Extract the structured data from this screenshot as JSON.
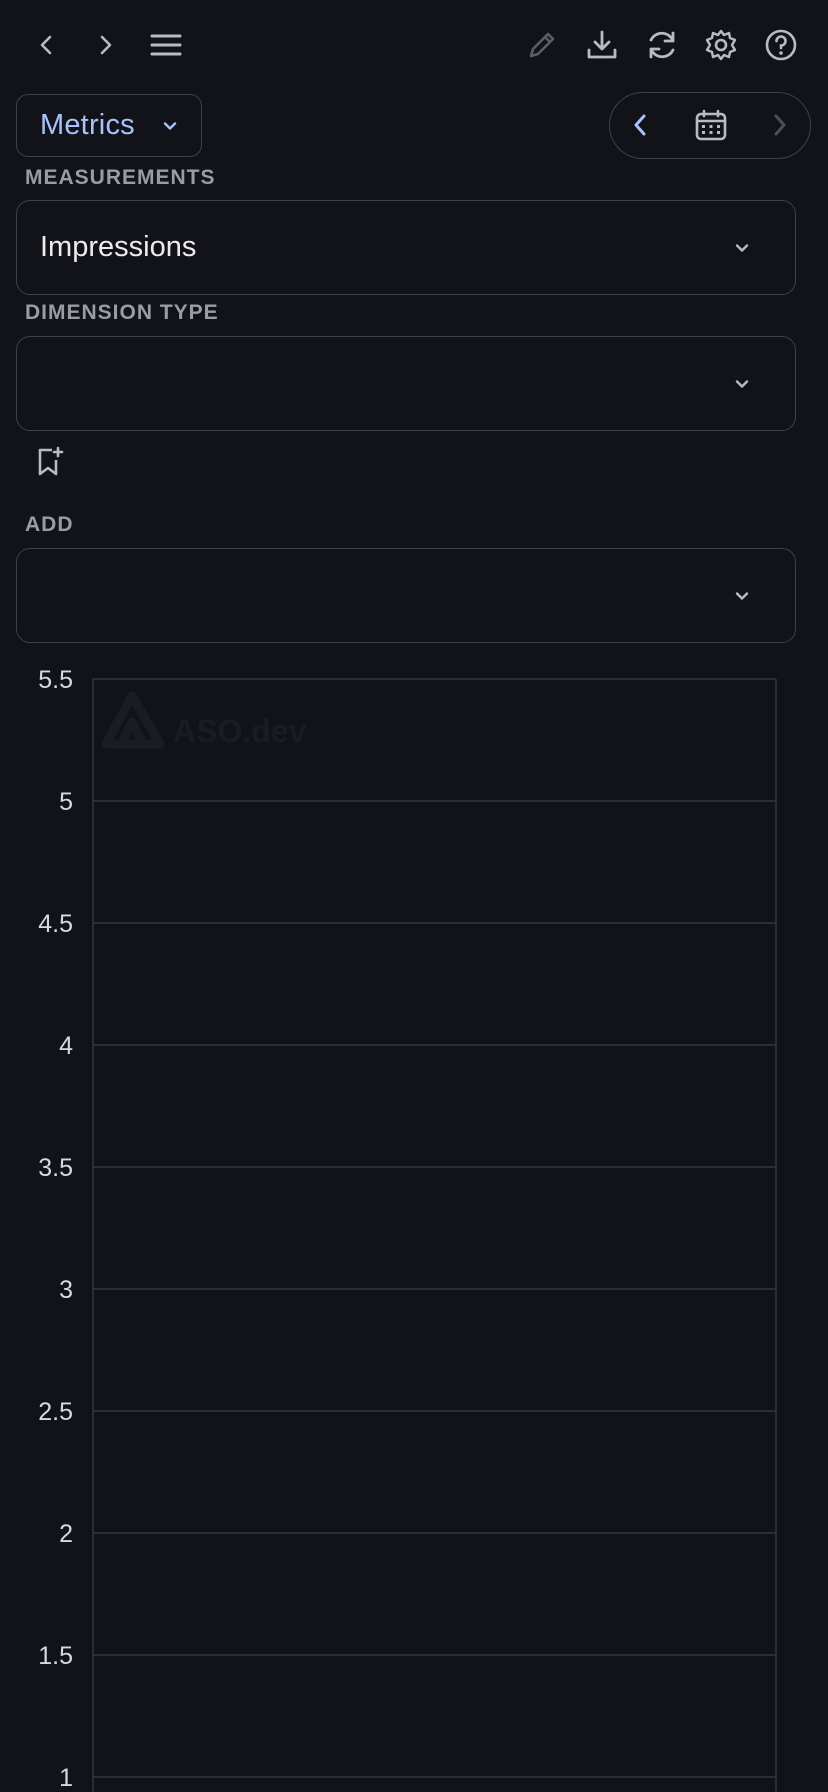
{
  "toolbar": {
    "icons": [
      "chevron-left-icon",
      "chevron-right-icon",
      "menu-icon",
      "pencil-icon",
      "download-icon",
      "refresh-icon",
      "gear-icon",
      "help-icon"
    ]
  },
  "metrics_menu": {
    "label": "Metrics"
  },
  "date_nav": {
    "icons": [
      "chevron-left-icon",
      "calendar-icon",
      "chevron-right-icon"
    ]
  },
  "measurements": {
    "label": "MEASUREMENTS",
    "value": "Impressions"
  },
  "dimension_type": {
    "label": "DIMENSION TYPE",
    "value": ""
  },
  "add": {
    "label": "ADD",
    "value": ""
  },
  "watermark": {
    "text": "ASO.dev"
  },
  "colors": {
    "background": "#121318",
    "border": "#3d4048",
    "accent": "#a9c2ff",
    "grid": "#33363d",
    "tick_text": "#d8d9de"
  },
  "chart_data": {
    "type": "line",
    "title": "",
    "xlabel": "",
    "ylabel": "",
    "ylim": [
      1,
      5.5
    ],
    "y_ticks": [
      "5.5",
      "5",
      "4.5",
      "4",
      "3.5",
      "3",
      "2.5",
      "2",
      "1.5",
      "1"
    ],
    "series": [],
    "grid": true
  }
}
